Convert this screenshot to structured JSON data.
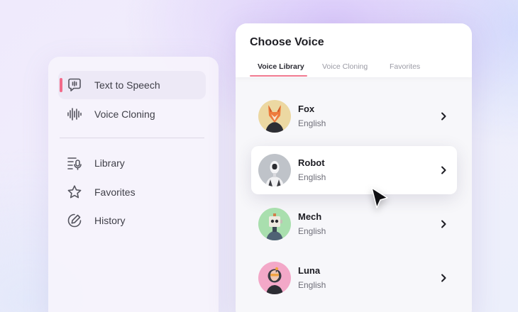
{
  "sidebar": {
    "items": [
      {
        "label": "Text to Speech",
        "icon": "chat-bubble-icon",
        "active": true
      },
      {
        "label": "Voice Cloning",
        "icon": "waveform-icon",
        "active": false
      },
      {
        "label": "Library",
        "icon": "library-mic-icon",
        "active": false
      },
      {
        "label": "Favorites",
        "icon": "star-icon",
        "active": false
      },
      {
        "label": "History",
        "icon": "edit-circle-icon",
        "active": false
      }
    ]
  },
  "panel": {
    "title": "Choose Voice",
    "tabs": [
      {
        "label": "Voice Library",
        "active": true
      },
      {
        "label": "Voice Cloning",
        "active": false
      },
      {
        "label": "Favorites",
        "active": false
      }
    ],
    "voices": [
      {
        "name": "Fox",
        "language": "English",
        "avatar": "fox-avatar",
        "selected": false
      },
      {
        "name": "Robot",
        "language": "English",
        "avatar": "robot-avatar",
        "selected": true
      },
      {
        "name": "Mech",
        "language": "English",
        "avatar": "mech-avatar",
        "selected": false
      },
      {
        "name": "Luna",
        "language": "English",
        "avatar": "luna-avatar",
        "selected": false
      }
    ]
  },
  "colors": {
    "accent": "#f0798f",
    "active_bar": "#f36a8a"
  }
}
